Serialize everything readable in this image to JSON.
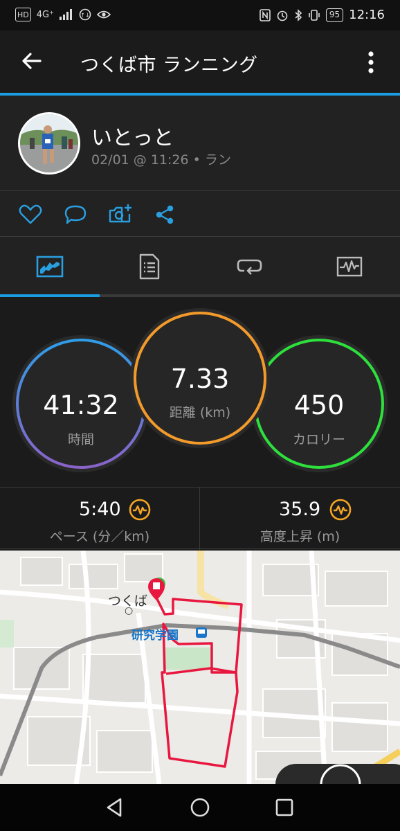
{
  "status_bar": {
    "hd": "HD",
    "network": "4G⁺",
    "battery": "95",
    "time": "12:16"
  },
  "app_bar": {
    "title": "つくば市 ランニング",
    "back_icon": "arrow-left-icon",
    "more_icon": "more-vert-icon"
  },
  "profile": {
    "name": "いとっと",
    "meta": "02/01 @ 11:26 • ラン"
  },
  "actions": [
    "heart-icon",
    "comment-icon",
    "add-photo-icon",
    "share-icon"
  ],
  "tabs": [
    {
      "name": "summary",
      "icon": "chart-icon",
      "active": true
    },
    {
      "name": "details",
      "icon": "document-icon",
      "active": false
    },
    {
      "name": "laps",
      "icon": "loop-icon",
      "active": false
    },
    {
      "name": "graphs",
      "icon": "activity-graph-icon",
      "active": false
    }
  ],
  "metrics": {
    "time": {
      "value": "41:32",
      "label": "時間"
    },
    "distance": {
      "value": "7.33",
      "label": "距離 (km)"
    },
    "calories": {
      "value": "450",
      "label": "カロリー"
    }
  },
  "stats": {
    "pace": {
      "value": "5:40",
      "label": "ペース (分／km)"
    },
    "elevation": {
      "value": "35.9",
      "label": "高度上昇 (m)"
    }
  },
  "map": {
    "city_label": "つくば",
    "city_label_dot": "○",
    "station_label": "研究学園",
    "route_color": "#e8173f"
  },
  "colors": {
    "accent": "#1a9ee3",
    "time_ring": "#6b74d6",
    "distance_ring": "#f39a2b",
    "calories_ring": "#2ee03c",
    "stat_icon": "#f5a623"
  }
}
